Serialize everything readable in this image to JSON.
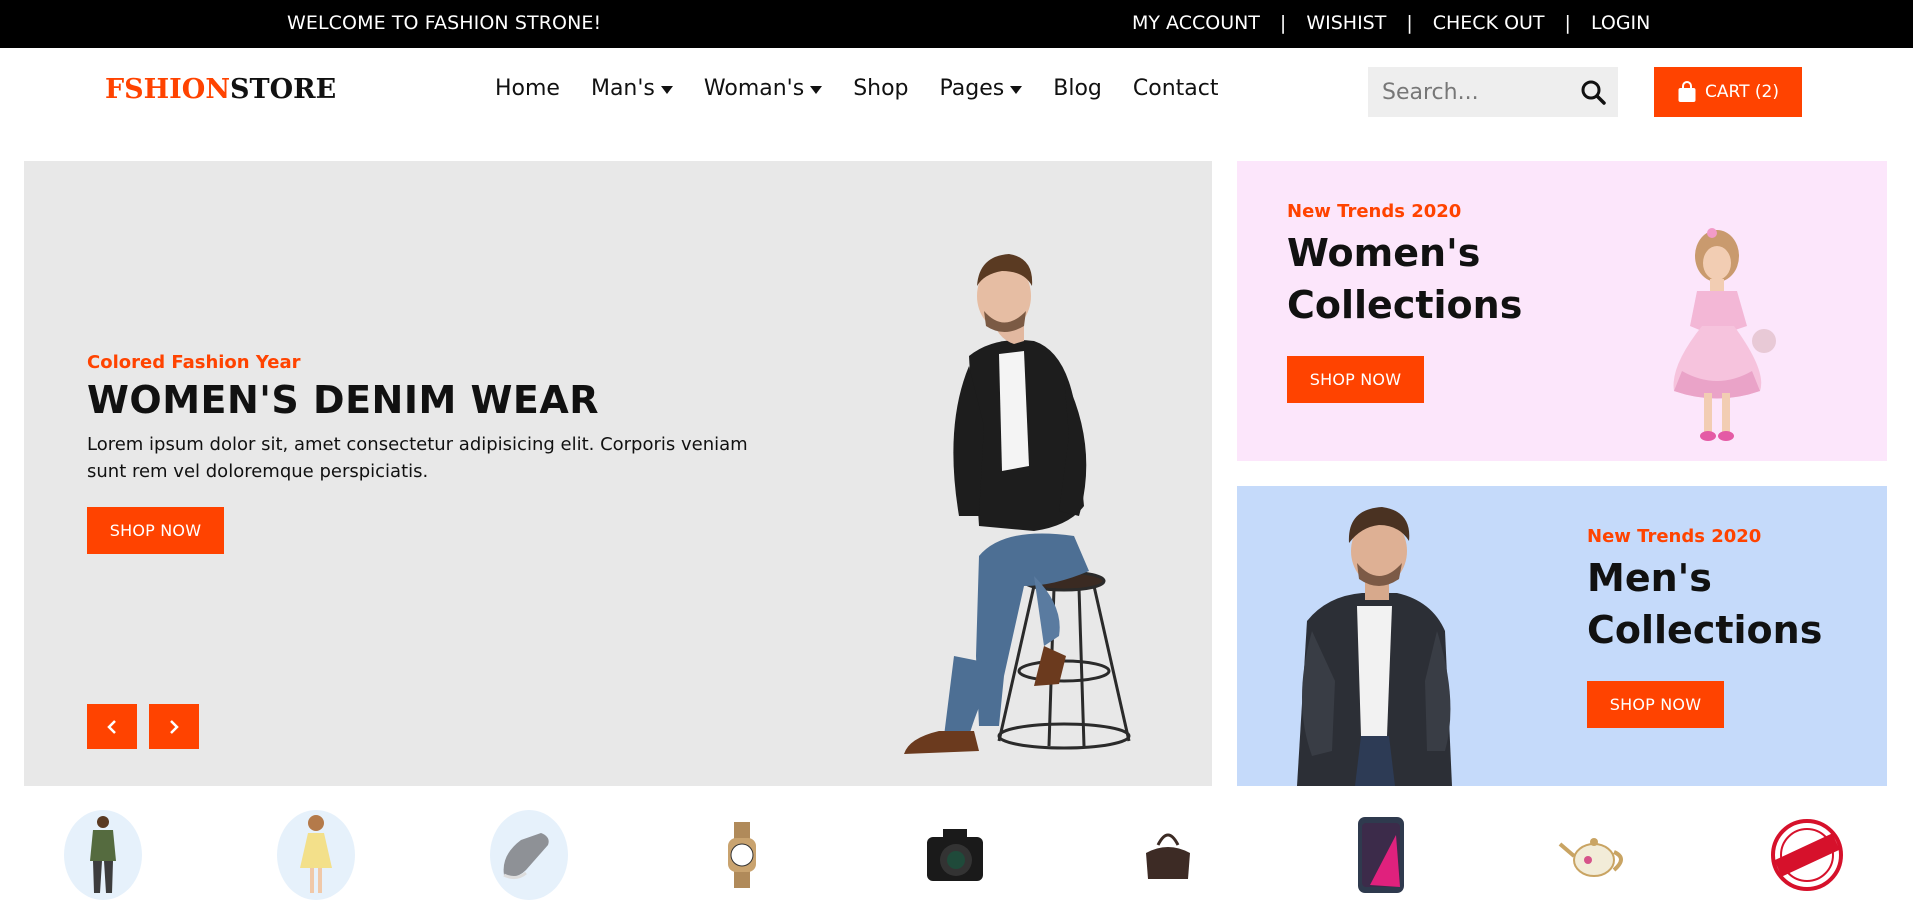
{
  "topbar": {
    "welcome": "WELCOME TO FASHION STRONE!",
    "links": [
      "MY ACCOUNT",
      "WISHIST",
      "CHECK OUT",
      "LOGIN"
    ],
    "separator": "|"
  },
  "header": {
    "logo_part1": "FSHION",
    "logo_part2": "STORE",
    "nav": [
      {
        "label": "Home",
        "dropdown": false
      },
      {
        "label": "Man's",
        "dropdown": true
      },
      {
        "label": "Woman's",
        "dropdown": true
      },
      {
        "label": "Shop",
        "dropdown": false
      },
      {
        "label": "Pages",
        "dropdown": true
      },
      {
        "label": "Blog",
        "dropdown": false
      },
      {
        "label": "Contact",
        "dropdown": false
      }
    ],
    "search_placeholder": "Search...",
    "cart_label": "CART (2)"
  },
  "hero": {
    "kicker": "Colored Fashion Year",
    "title": "WOMEN'S DENIM WEAR",
    "description": "Lorem ipsum dolor sit, amet consectetur adipisicing elit. Corporis veniam sunt rem vel doloremque perspiciatis.",
    "button": "SHOP NOW"
  },
  "promos": {
    "women": {
      "kicker": "New Trends 2020",
      "title_line1": "Women's",
      "title_line2": "Collections",
      "button": "SHOP NOW"
    },
    "men": {
      "kicker": "New Trends 2020",
      "title_line1": "Men's",
      "title_line2": "Collections",
      "button": "SHOP NOW"
    }
  },
  "categories": [
    "man-figure-icon",
    "girl-figure-icon",
    "sneaker-icon",
    "watch-icon",
    "camera-icon",
    "handbag-icon",
    "smartphone-icon",
    "teapot-icon",
    "special-offer-stamp-icon"
  ],
  "colors": {
    "accent": "#ff4300",
    "topbar": "#000000",
    "hero_bg": "#e8e8e8",
    "women_bg": "#fce6fb",
    "men_bg": "#c5dafa"
  }
}
